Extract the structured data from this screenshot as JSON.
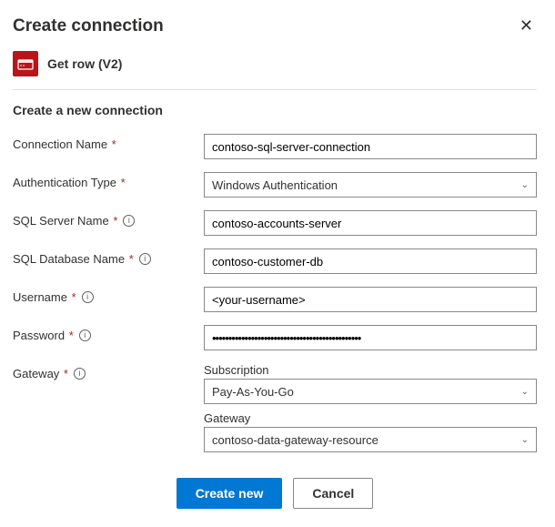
{
  "dialog": {
    "title": "Create connection",
    "section_heading": "Create a new connection"
  },
  "connector": {
    "name": "Get row (V2)",
    "icon_color": "#ba141a"
  },
  "fields": {
    "connection_name": {
      "label": "Connection Name",
      "value": "contoso-sql-server-connection"
    },
    "auth_type": {
      "label": "Authentication Type",
      "value": "Windows Authentication"
    },
    "sql_server": {
      "label": "SQL Server Name",
      "value": "contoso-accounts-server"
    },
    "sql_database": {
      "label": "SQL Database Name",
      "value": "contoso-customer-db"
    },
    "username": {
      "label": "Username",
      "value": "<your-username>"
    },
    "password": {
      "label": "Password",
      "value": "••••••••••••••••••••••••••••••••••••••••••••••"
    },
    "gateway": {
      "label": "Gateway",
      "subscription_label": "Subscription",
      "subscription_value": "Pay-As-You-Go",
      "gateway_label": "Gateway",
      "gateway_value": "contoso-data-gateway-resource"
    }
  },
  "buttons": {
    "primary": "Create new",
    "secondary": "Cancel"
  }
}
